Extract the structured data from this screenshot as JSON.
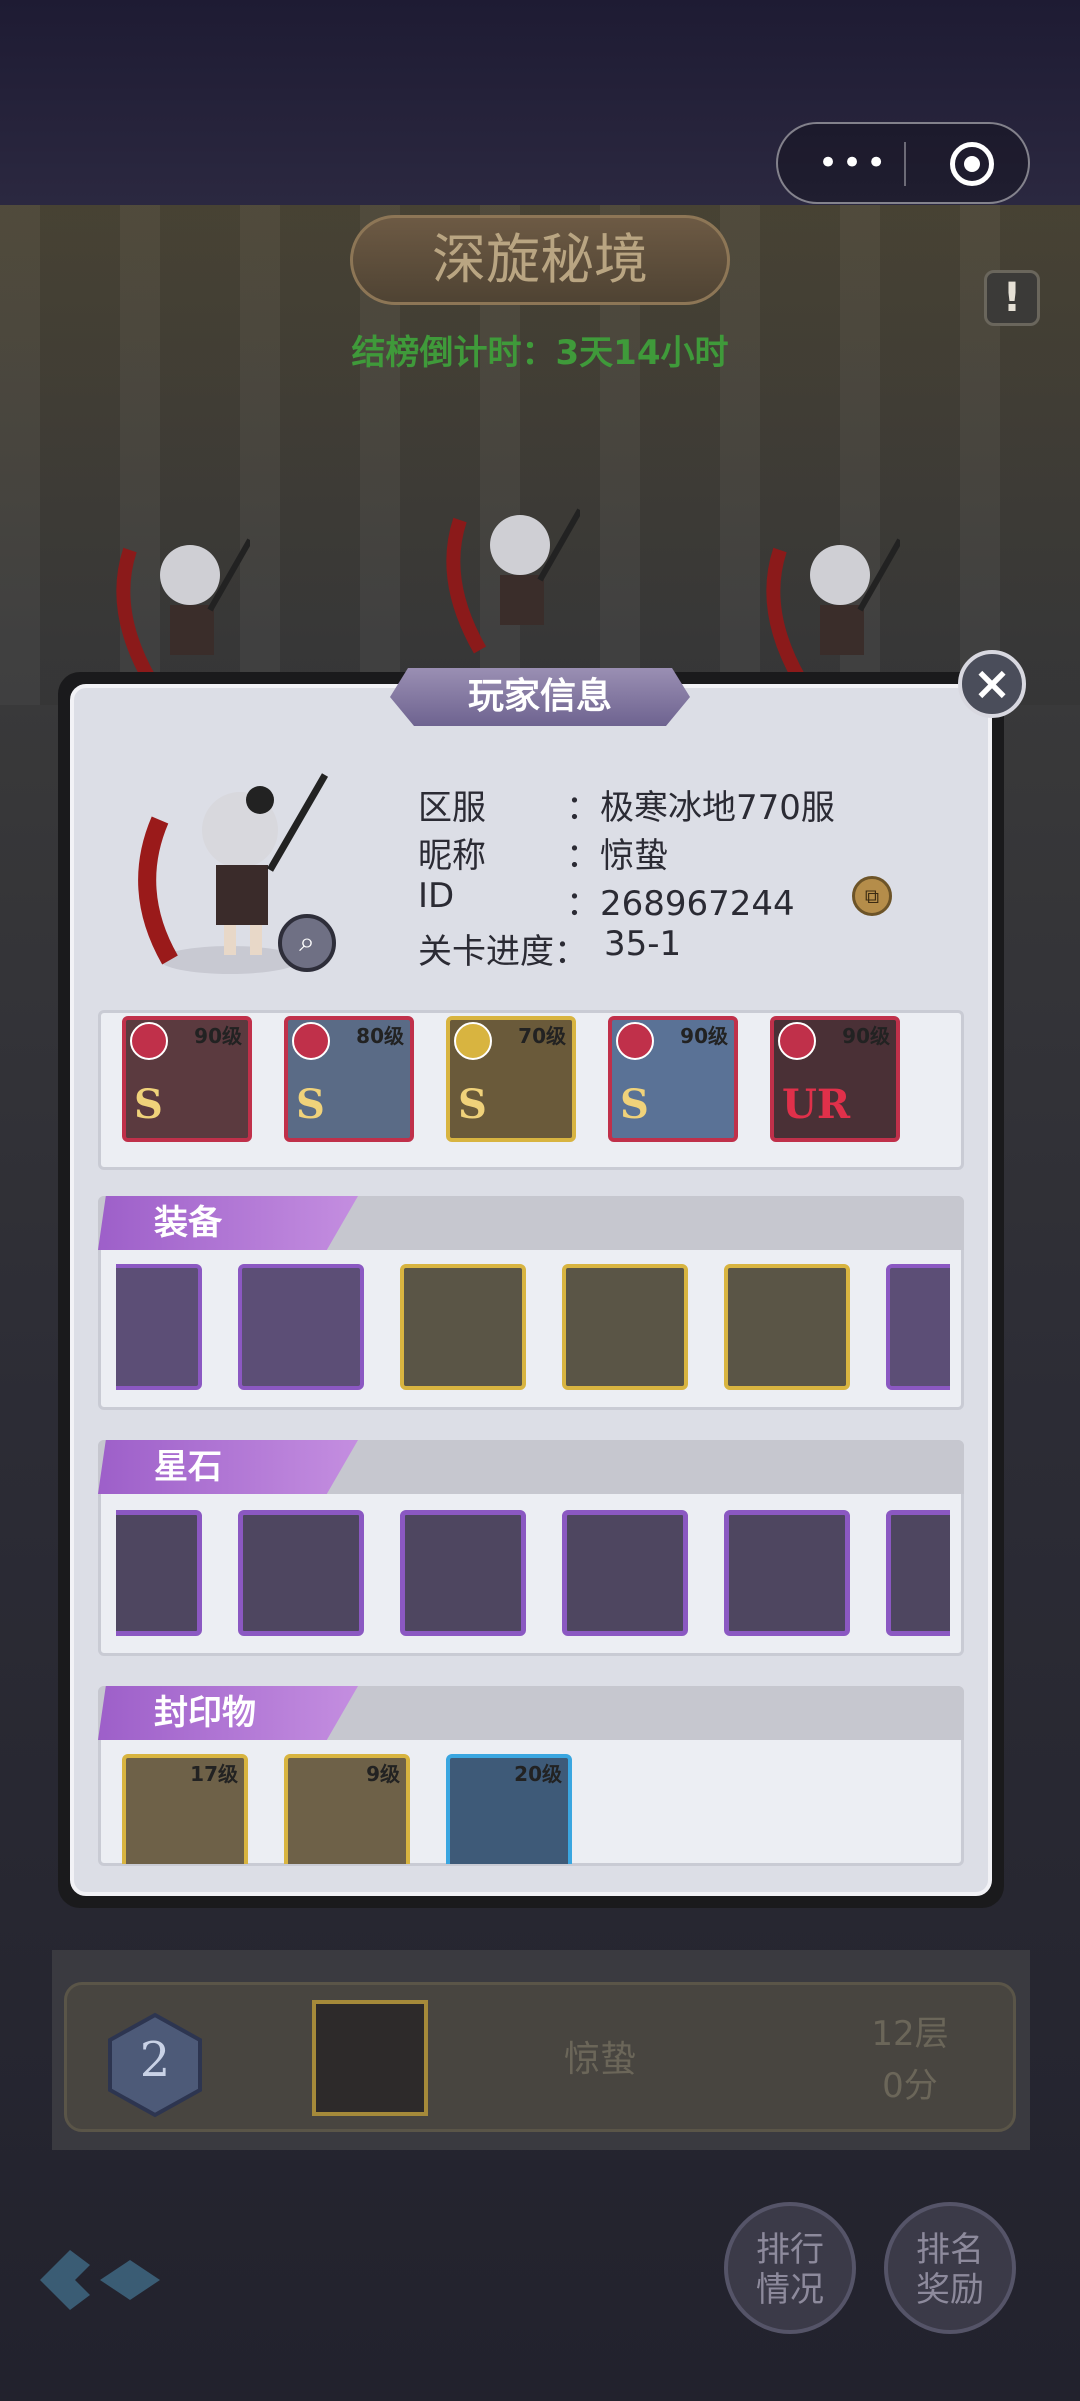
{
  "header": {
    "menu_dots": "•••",
    "title": "深旋秘境",
    "info_mark": "!",
    "countdown": "结榜倒计时：3天14小时"
  },
  "dialog": {
    "title": "玩家信息",
    "close_symbol": "×",
    "fields": [
      {
        "label": "区服",
        "value": "：极寒冰地770服"
      },
      {
        "label": "昵称",
        "value": "：惊蛰"
      },
      {
        "label": "ID",
        "value": "：268967244"
      },
      {
        "label": "关卡进度：",
        "value": "35-1"
      }
    ],
    "heroes": [
      {
        "level": "90级",
        "rank": "S"
      },
      {
        "level": "80级",
        "rank": "S"
      },
      {
        "level": "70级",
        "rank": "S"
      },
      {
        "level": "90级",
        "rank": "S"
      },
      {
        "level": "90级",
        "rank": "UR"
      }
    ],
    "sections": {
      "equipment": "装备",
      "stones": "星石",
      "seals": "封印物"
    },
    "equipment_items": [
      "spear-icon",
      "spellbook-icon",
      "witch-hat-icon",
      "skirt-icon",
      "ring-icon",
      "staff-icon"
    ],
    "stone_items": [
      "square-gem-icon",
      "heart-gem-icon",
      "star-gem-icon",
      "diamond-gem-icon",
      "shield-gem-icon",
      "round-gem-icon"
    ],
    "seal_items": [
      {
        "level": "17级"
      },
      {
        "level": "9级"
      },
      {
        "level": "20级"
      }
    ]
  },
  "ranking": {
    "position": "2",
    "name": "惊蛰",
    "floor": "12层",
    "score": "0分"
  },
  "buttons": {
    "rank_status": "排行\n情况",
    "rank_reward": "排名\n奖励"
  }
}
